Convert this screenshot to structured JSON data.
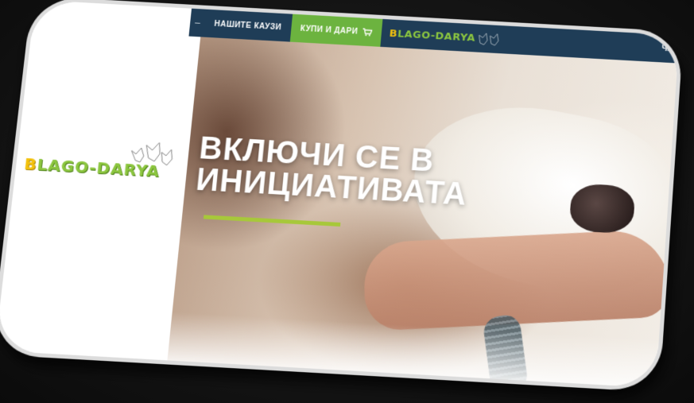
{
  "nav": {
    "dash": "–",
    "items": [
      {
        "label": "НАШИТЕ КАУЗИ"
      },
      {
        "label": "КУПИ И ДАРИ"
      }
    ],
    "cart_icon": "cart-icon",
    "logo_prefix": "B",
    "logo_rest": "LAGO-DARYA",
    "right_partial": "ЧУ"
  },
  "side_logo": {
    "prefix": "B",
    "rest": "LAGO-DARYA"
  },
  "hero": {
    "line1": "ВКЛЮЧИ СЕ В",
    "line2": "ИНИЦИАТИВАТА"
  },
  "colors": {
    "nav_bg": "#1f3d57",
    "accent_green": "#6cb33f",
    "underline": "#a7c83a",
    "logo_green": "#8cc63f",
    "logo_yellow": "#f4c20d"
  }
}
